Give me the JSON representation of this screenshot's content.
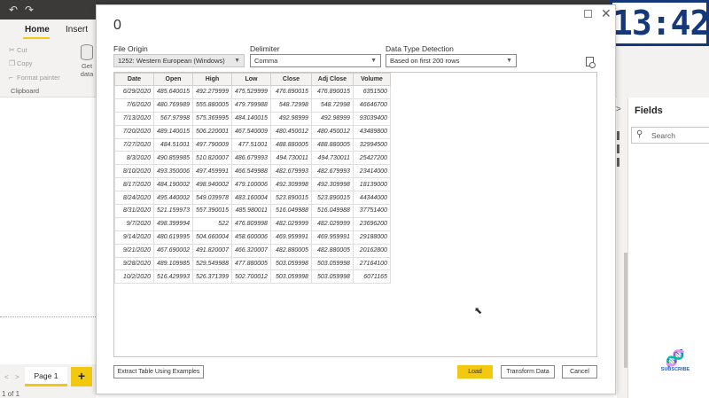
{
  "titlebar": {
    "undo_icon": "undo-icon",
    "redo_icon": "redo-icon"
  },
  "ribbon": {
    "tabs": [
      {
        "label": "Home"
      },
      {
        "label": "Insert"
      }
    ],
    "clipboard": {
      "cut": "Cut",
      "copy": "Copy",
      "format_painter": "Format painter",
      "group_label": "Clipboard"
    },
    "get_data": {
      "line1": "Get",
      "line2": "data"
    }
  },
  "pages": {
    "page_tab": "Page 1",
    "add_page": "+",
    "page_count": "1 of 1",
    "nav_left": "<",
    "nav_right": ">"
  },
  "fields_pane": {
    "title": "Fields",
    "search_placeholder": "Search",
    "collapse": ">"
  },
  "clock": {
    "time": "13:42"
  },
  "subscribe": {
    "label": "SUBSCRIBE"
  },
  "dialog": {
    "title": "0",
    "file_origin": {
      "label": "File Origin",
      "value": "1252: Western European (Windows)"
    },
    "delimiter": {
      "label": "Delimiter",
      "value": "Comma"
    },
    "detection": {
      "label": "Data Type Detection",
      "value": "Based on first 200 rows"
    },
    "table": {
      "headers": [
        "Date",
        "Open",
        "High",
        "Low",
        "Close",
        "Adj Close",
        "Volume"
      ],
      "rows": [
        [
          "6/29/2020",
          "485.640015",
          "492.279999",
          "475.529999",
          "476.890015",
          "476.890015",
          "6351500"
        ],
        [
          "7/6/2020",
          "480.769989",
          "555.880005",
          "479.799988",
          "548.72998",
          "548.72998",
          "46646700"
        ],
        [
          "7/13/2020",
          "567.97998",
          "575.369995",
          "484.140015",
          "492.98999",
          "492.98999",
          "93039400"
        ],
        [
          "7/20/2020",
          "489.140015",
          "506.220001",
          "467.540009",
          "480.450012",
          "480.450012",
          "43489800"
        ],
        [
          "7/27/2020",
          "484.51001",
          "497.790009",
          "477.51001",
          "488.880005",
          "488.880005",
          "32994500"
        ],
        [
          "8/3/2020",
          "490.859985",
          "510.820007",
          "486.679993",
          "494.730011",
          "494.730011",
          "25427200"
        ],
        [
          "8/10/2020",
          "493.350006",
          "497.459991",
          "466.549988",
          "482.679993",
          "482.679993",
          "23414000"
        ],
        [
          "8/17/2020",
          "484.190002",
          "498.940002",
          "479.100006",
          "492.309998",
          "492.309998",
          "18139000"
        ],
        [
          "8/24/2020",
          "495.440002",
          "549.039978",
          "483.160004",
          "523.890015",
          "523.890015",
          "44344000"
        ],
        [
          "8/31/2020",
          "521.159973",
          "557.390015",
          "485.980011",
          "516.049988",
          "516.049988",
          "37751400"
        ],
        [
          "9/7/2020",
          "498.399994",
          "522",
          "476.809998",
          "482.029999",
          "482.029999",
          "23696200"
        ],
        [
          "9/14/2020",
          "480.619995",
          "504.660004",
          "458.600006",
          "469.959991",
          "469.959991",
          "29188000"
        ],
        [
          "9/21/2020",
          "467.690002",
          "491.820007",
          "466.320007",
          "482.880005",
          "482.880005",
          "20162800"
        ],
        [
          "9/28/2020",
          "489.109985",
          "529.549988",
          "477.880005",
          "503.059998",
          "503.059998",
          "27164100"
        ],
        [
          "10/2/2020",
          "516.429993",
          "526.371399",
          "502.700012",
          "503.059998",
          "503.059998",
          "6071165"
        ]
      ]
    },
    "buttons": {
      "extract": "Extract Table Using Examples",
      "load": "Load",
      "transform": "Transform Data",
      "cancel": "Cancel"
    }
  },
  "colors": {
    "accent": "#f2c811",
    "titlebar": "#3b3a39",
    "clock_blue": "#15387a"
  }
}
